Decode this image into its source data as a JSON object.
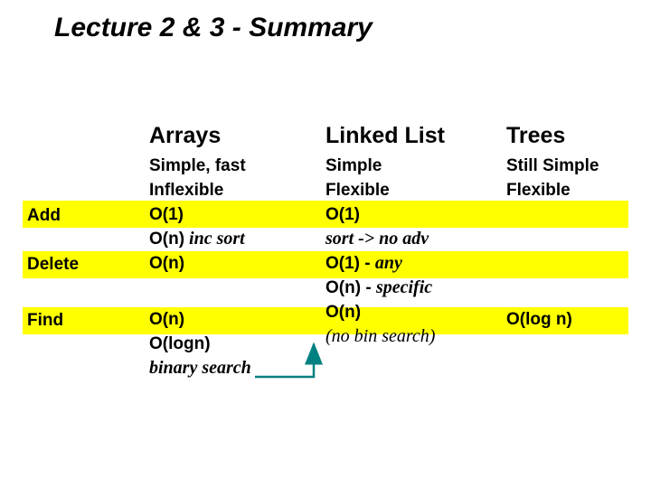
{
  "title": "Lecture 2 & 3 - Summary",
  "headers": {
    "arrays": "Arrays",
    "linked": "Linked List",
    "trees": "Trees"
  },
  "rowLabels": {
    "add": "Add",
    "delete": "Delete",
    "find": "Find"
  },
  "arrays": {
    "l1": "Simple, fast",
    "l2": "Inflexible",
    "l3": "O(1)",
    "l4a": "O(n)",
    "l4b": " inc sort",
    "l5": "O(n)",
    "l6": "O(n)",
    "l7": "O(logn)",
    "l8": "binary search"
  },
  "linked": {
    "l1": "Simple",
    "l2": "Flexible",
    "l3": "O(1)",
    "l4": " sort -> no adv",
    "l5a": "O(1)",
    "l5b": " - ",
    "l5c": "any",
    "l6a": "O(n)",
    "l6b": " - ",
    "l6c": "specific",
    "l7": "O(n)",
    "l8": "(no bin search)"
  },
  "trees": {
    "l1": "Still Simple",
    "l2": "Flexible",
    "find": "O(log n)"
  },
  "chart_data": {
    "type": "table",
    "title": "Lecture 2 & 3 - Summary",
    "columns": [
      "Arrays",
      "Linked List",
      "Trees"
    ],
    "rows": [
      "Add",
      "Delete",
      "Find"
    ],
    "cells": {
      "properties": {
        "Arrays": [
          "Simple, fast",
          "Inflexible"
        ],
        "Linked List": [
          "Simple",
          "Flexible"
        ],
        "Trees": [
          "Still Simple",
          "Flexible"
        ]
      },
      "Add": {
        "Arrays": "O(1) / O(n) inc sort",
        "Linked List": "O(1) / sort -> no adv",
        "Trees": ""
      },
      "Delete": {
        "Arrays": "O(n)",
        "Linked List": "O(1) - any / O(n) - specific",
        "Trees": ""
      },
      "Find": {
        "Arrays": "O(n) / O(logn) binary search",
        "Linked List": "O(n) (no bin search)",
        "Trees": "O(log n)"
      }
    }
  }
}
